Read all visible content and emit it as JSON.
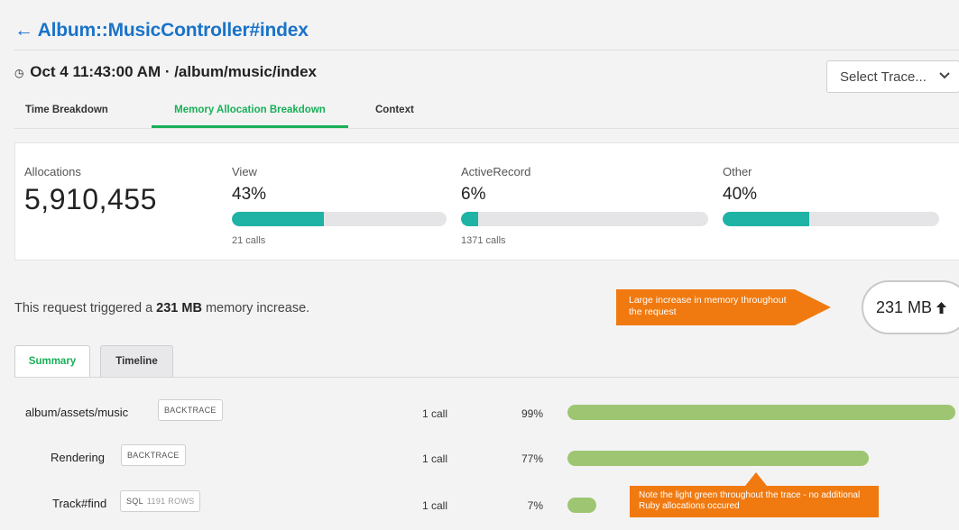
{
  "header": {
    "back_arrow": "←",
    "endpoint": "Album::MusicController#index",
    "clock_glyph": "◷",
    "trace_title": "Oct 4 11:43:00 AM · /album/music/index",
    "select_placeholder": "Select Trace...",
    "select_icon": "chevron-down-icon"
  },
  "tabs": [
    {
      "label": "Time Breakdown",
      "active": false
    },
    {
      "label": "Memory Allocation Breakdown",
      "active": true
    },
    {
      "label": "Context",
      "active": false
    }
  ],
  "stats": {
    "allocations_label": "Allocations",
    "allocations_value": "5,910,455",
    "categories": [
      {
        "label": "View",
        "pct": "43%",
        "fill_fraction": 0.43,
        "calls": "21 calls"
      },
      {
        "label": "ActiveRecord",
        "pct": "6%",
        "fill_fraction": 0.06,
        "calls": "1371 calls"
      },
      {
        "label": "Other",
        "pct": "40%",
        "fill_fraction": 0.4,
        "calls": ""
      }
    ]
  },
  "memory": {
    "note_prefix": "This request triggered a ",
    "note_value": "231 MB",
    "note_suffix": " memory increase.",
    "callout": "Large increase in memory throughout the request",
    "pill_value": "231 MB",
    "pill_icon": "arrow-up-icon",
    "arrow_glyph": "🠉"
  },
  "subtabs": [
    {
      "label": "Summary",
      "active": true
    },
    {
      "label": "Timeline",
      "active": false
    }
  ],
  "rows": [
    {
      "label": "album/assets/music",
      "tag": "BACKTRACE",
      "tag_extra": "",
      "calls": "1 call",
      "pct": "99%",
      "fraction": 0.99
    },
    {
      "label": "Rendering",
      "tag": "BACKTRACE",
      "tag_extra": "",
      "calls": "1 call",
      "pct": "77%",
      "fraction": 0.77
    },
    {
      "label": "Track#find",
      "tag": "SQL",
      "tag_extra": "1191 ROWS",
      "calls": "1 call",
      "pct": "7%",
      "fraction": 0.07
    }
  ],
  "note_callout": "Note the light green throughout the trace - no additional Ruby allocations occured",
  "colors": {
    "link": "#1a73c8",
    "active_tab": "#18b057",
    "bar_teal": "#1eb3a5",
    "bar_green": "#9ec672",
    "callout_orange": "#f07a10"
  }
}
